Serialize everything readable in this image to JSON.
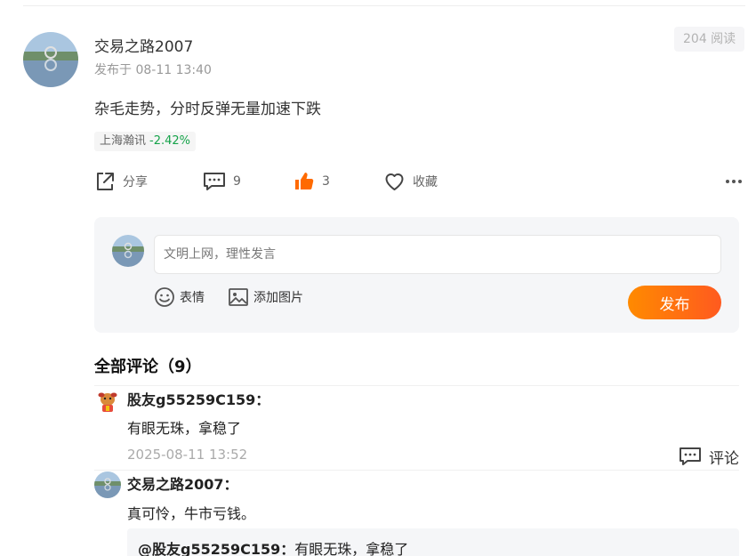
{
  "post": {
    "author": "交易之路2007",
    "time": "发布于 08-11 13:40",
    "reads": "204 阅读",
    "text": "杂毛走势，分时反弹无量加速下跌",
    "stock": {
      "name": "上海瀚讯",
      "change": "-2.42%",
      "change_color": "#16a34a"
    }
  },
  "actions": {
    "share": "分享",
    "comments": "9",
    "likes": "3",
    "favorite": "收藏",
    "like_color": "#ff6a00"
  },
  "comment_box": {
    "placeholder": "文明上网，理性发言",
    "emoji": "表情",
    "image": "添加图片",
    "publish": "发布"
  },
  "comments_header": "全部评论（9）",
  "comments": [
    {
      "author": "股友g55259C159：",
      "text": "有眼无珠，拿稳了",
      "time": "2025-08-11 13:52",
      "reply": "评论"
    },
    {
      "author": "交易之路2007：",
      "text": "真可怜，牛市亏钱。",
      "quote_author": "@股友g55259C159：",
      "quote_text": "有眼无珠，拿稳了"
    }
  ]
}
